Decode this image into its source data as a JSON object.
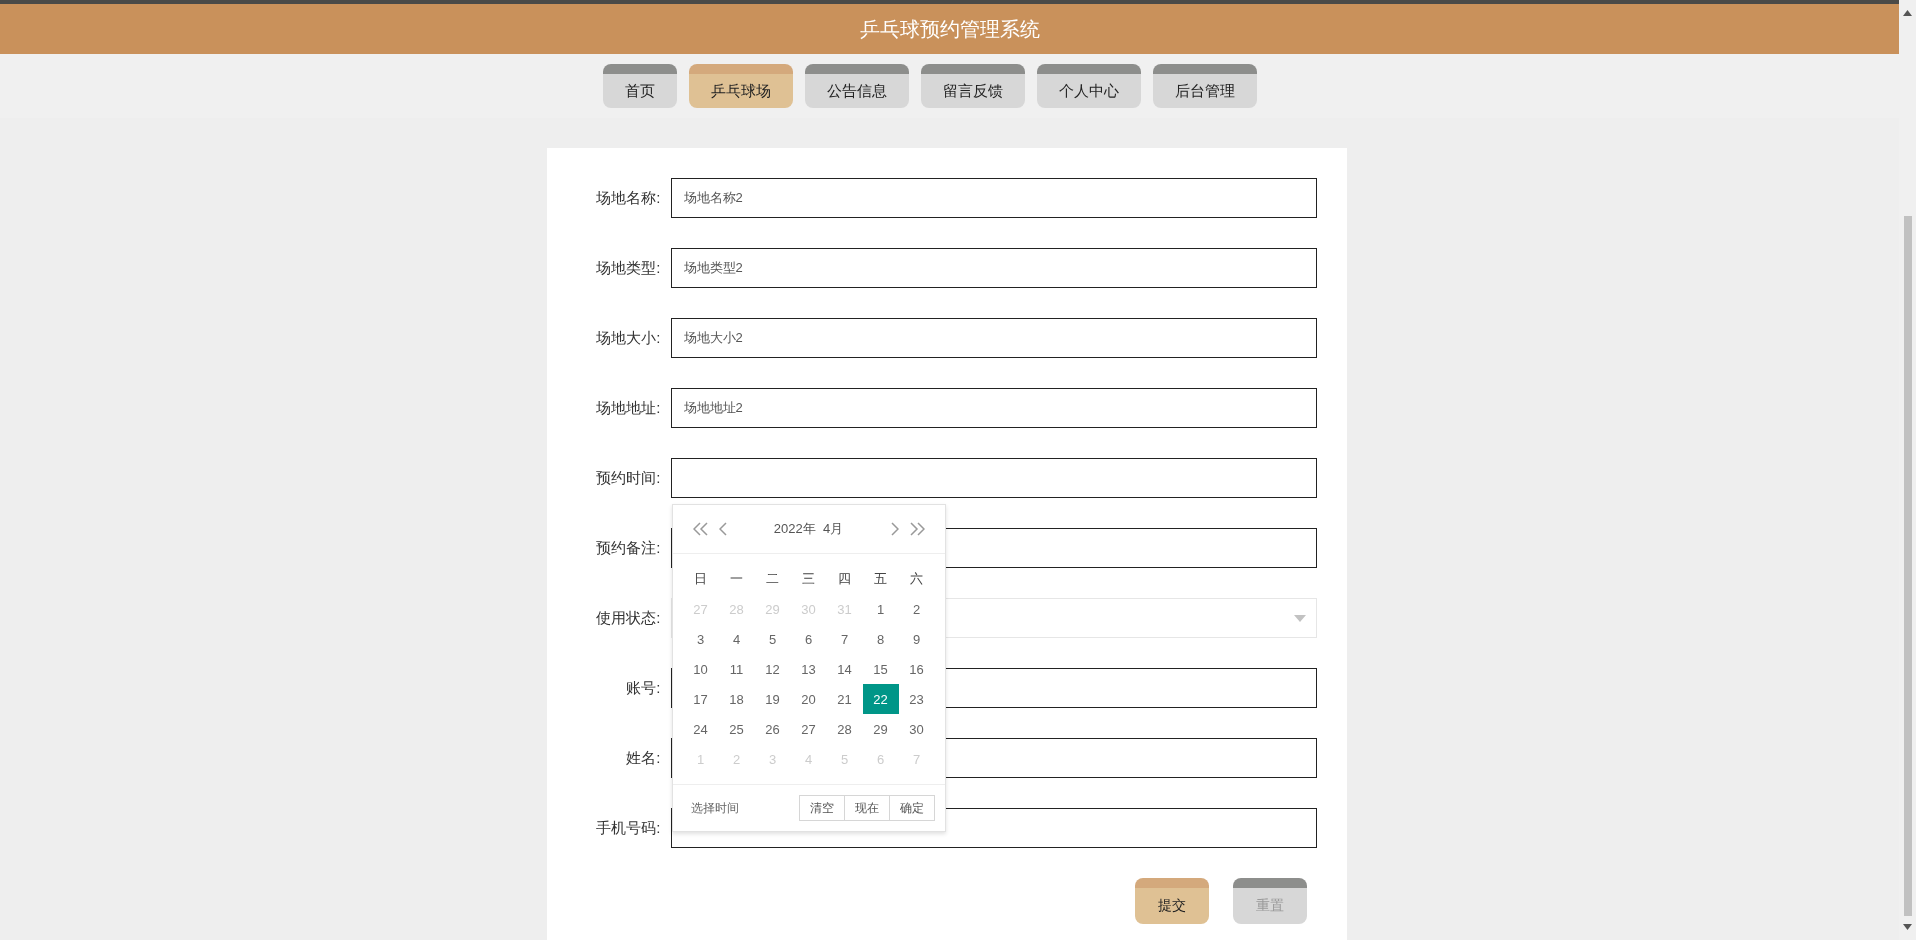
{
  "header": {
    "title": "乒乓球预约管理系统"
  },
  "nav": [
    {
      "label": "首页",
      "selected": false
    },
    {
      "label": "乒乓球场",
      "selected": true
    },
    {
      "label": "公告信息",
      "selected": false
    },
    {
      "label": "留言反馈",
      "selected": false
    },
    {
      "label": "个人中心",
      "selected": false
    },
    {
      "label": "后台管理",
      "selected": false
    }
  ],
  "form": {
    "fields": [
      {
        "label": "场地名称:",
        "kind": "text",
        "value": "场地名称2"
      },
      {
        "label": "场地类型:",
        "kind": "text",
        "value": "场地类型2"
      },
      {
        "label": "场地大小:",
        "kind": "text",
        "value": "场地大小2"
      },
      {
        "label": "场地地址:",
        "kind": "text",
        "value": "场地地址2"
      },
      {
        "label": "预约时间:",
        "kind": "date"
      },
      {
        "label": "预约备注:",
        "kind": "text"
      },
      {
        "label": "使用状态:",
        "kind": "select"
      },
      {
        "label": "账号:",
        "kind": "text"
      },
      {
        "label": "姓名:",
        "kind": "text"
      },
      {
        "label": "手机号码:",
        "kind": "text"
      }
    ],
    "buttons": [
      {
        "label": "提交",
        "kind": "primary"
      },
      {
        "label": "重置",
        "kind": "secondary"
      }
    ]
  },
  "date_picker": {
    "month_title": "2022年  4月",
    "weekdays": [
      "日",
      "一",
      "二",
      "三",
      "四",
      "五",
      "六"
    ],
    "days": [
      {
        "label": "27",
        "outside": true,
        "selected": false
      },
      {
        "label": "28",
        "outside": true,
        "selected": false
      },
      {
        "label": "29",
        "outside": true,
        "selected": false
      },
      {
        "label": "30",
        "outside": true,
        "selected": false
      },
      {
        "label": "31",
        "outside": true,
        "selected": false
      },
      {
        "label": "1",
        "outside": false,
        "selected": false
      },
      {
        "label": "2",
        "outside": false,
        "selected": false
      },
      {
        "label": "3",
        "outside": false,
        "selected": false
      },
      {
        "label": "4",
        "outside": false,
        "selected": false
      },
      {
        "label": "5",
        "outside": false,
        "selected": false
      },
      {
        "label": "6",
        "outside": false,
        "selected": false
      },
      {
        "label": "7",
        "outside": false,
        "selected": false
      },
      {
        "label": "8",
        "outside": false,
        "selected": false
      },
      {
        "label": "9",
        "outside": false,
        "selected": false
      },
      {
        "label": "10",
        "outside": false,
        "selected": false
      },
      {
        "label": "11",
        "outside": false,
        "selected": false
      },
      {
        "label": "12",
        "outside": false,
        "selected": false
      },
      {
        "label": "13",
        "outside": false,
        "selected": false
      },
      {
        "label": "14",
        "outside": false,
        "selected": false
      },
      {
        "label": "15",
        "outside": false,
        "selected": false
      },
      {
        "label": "16",
        "outside": false,
        "selected": false
      },
      {
        "label": "17",
        "outside": false,
        "selected": false
      },
      {
        "label": "18",
        "outside": false,
        "selected": false
      },
      {
        "label": "19",
        "outside": false,
        "selected": false
      },
      {
        "label": "20",
        "outside": false,
        "selected": false
      },
      {
        "label": "21",
        "outside": false,
        "selected": false
      },
      {
        "label": "22",
        "outside": false,
        "selected": true
      },
      {
        "label": "23",
        "outside": false,
        "selected": false
      },
      {
        "label": "24",
        "outside": false,
        "selected": false
      },
      {
        "label": "25",
        "outside": false,
        "selected": false
      },
      {
        "label": "26",
        "outside": false,
        "selected": false
      },
      {
        "label": "27",
        "outside": false,
        "selected": false
      },
      {
        "label": "28",
        "outside": false,
        "selected": false
      },
      {
        "label": "29",
        "outside": false,
        "selected": false
      },
      {
        "label": "30",
        "outside": false,
        "selected": false
      },
      {
        "label": "1",
        "outside": true,
        "selected": false
      },
      {
        "label": "2",
        "outside": true,
        "selected": false
      },
      {
        "label": "3",
        "outside": true,
        "selected": false
      },
      {
        "label": "4",
        "outside": true,
        "selected": false
      },
      {
        "label": "5",
        "outside": true,
        "selected": false
      },
      {
        "label": "6",
        "outside": true,
        "selected": false
      },
      {
        "label": "7",
        "outside": true,
        "selected": false
      }
    ],
    "footer_label": "选择时间",
    "buttons": [
      "清空",
      "现在",
      "确定"
    ]
  }
}
